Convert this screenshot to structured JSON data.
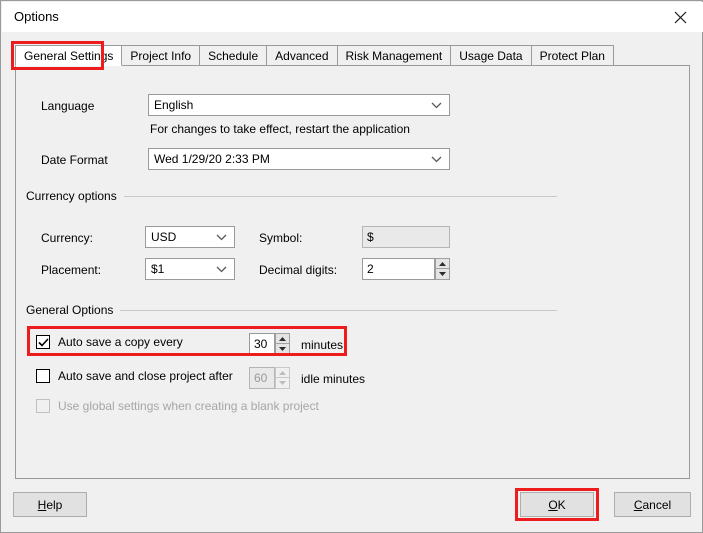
{
  "window": {
    "title": "Options",
    "close_icon": "close-icon"
  },
  "tabs": [
    {
      "label": "General Settings",
      "selected": true
    },
    {
      "label": "Project Info",
      "selected": false
    },
    {
      "label": "Schedule",
      "selected": false
    },
    {
      "label": "Advanced",
      "selected": false
    },
    {
      "label": "Risk Management",
      "selected": false
    },
    {
      "label": "Usage Data",
      "selected": false
    },
    {
      "label": "Protect Plan",
      "selected": false
    }
  ],
  "general_settings": {
    "language_label": "Language",
    "language_value": "English",
    "language_hint": "For changes to take effect, restart the application",
    "date_format_label": "Date Format",
    "date_format_value": "Wed 1/29/20 2:33 PM"
  },
  "currency_options": {
    "group_label": "Currency options",
    "currency_label": "Currency:",
    "currency_value": "USD",
    "placement_label": "Placement:",
    "placement_value": "$1",
    "symbol_label": "Symbol:",
    "symbol_value": "$",
    "decimal_digits_label": "Decimal digits:",
    "decimal_digits_value": "2"
  },
  "general_options": {
    "group_label": "General Options",
    "auto_save_copy": {
      "label": "Auto save a copy every",
      "checked": true,
      "value": "30",
      "unit": "minutes",
      "highlighted": true
    },
    "auto_save_close": {
      "label": "Auto save and close project after",
      "checked": false,
      "value": "60",
      "unit": "idle minutes"
    },
    "use_global_settings": {
      "label": "Use global settings when creating a blank project",
      "checked": false,
      "disabled": true
    }
  },
  "buttons": {
    "help": {
      "prefix": "",
      "accel": "H",
      "suffix": "elp"
    },
    "ok": {
      "prefix": "",
      "accel": "O",
      "suffix": "K"
    },
    "cancel": {
      "prefix": "",
      "accel": "C",
      "suffix": "ancel"
    }
  },
  "annotation_color": "#ee1c1c"
}
